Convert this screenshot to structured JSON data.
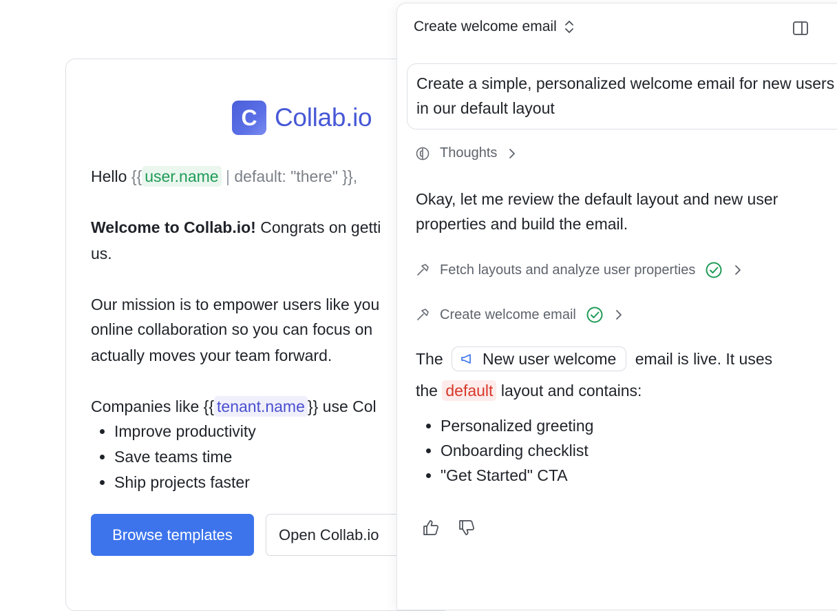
{
  "email": {
    "brand": {
      "initial": "C",
      "name": "Collab.io"
    },
    "greeting": {
      "hello": "Hello",
      "open": "{{",
      "var": "user.name",
      "sep": "|",
      "default_text": "default: \"there\"",
      "close": "}},"
    },
    "welcome": {
      "bold": "Welcome to Collab.io!",
      "rest": "Congrats on getti",
      "line2": "us."
    },
    "mission": {
      "line1": "Our mission is to empower users like you",
      "line2": "online collaboration so you can focus on",
      "line3": "actually moves your team forward."
    },
    "companies": {
      "before": "Companies like",
      "open": "{{",
      "var": "tenant.name",
      "close": "}}",
      "after": "use Col"
    },
    "bullets": [
      "Improve productivity",
      "Save teams time",
      "Ship projects faster"
    ],
    "buttons": {
      "primary": "Browse templates",
      "secondary": "Open Collab.io"
    }
  },
  "panel": {
    "title": "Create welcome email",
    "prompt": "Create a simple, personalized welcome email for new users in our default layout",
    "thoughts_label": "Thoughts",
    "reply_line1": "Okay, let me review the default layout and new user",
    "reply_line2": "properties and build the email.",
    "steps": [
      {
        "label": "Fetch layouts and analyze user properties"
      },
      {
        "label": "Create welcome email"
      }
    ],
    "summary": {
      "the": "The",
      "template_name": "New user welcome",
      "is_live": "email is live. It uses",
      "the2": "the",
      "layout": "default",
      "contains": "layout and contains:"
    },
    "contents": [
      "Personalized greeting",
      "Onboarding checklist",
      "\"Get Started\" CTA"
    ]
  },
  "colors": {
    "brand": "#4758d6",
    "primary_button": "#3d74ec",
    "success": "#1f9b57",
    "variable_green": "#1f9b57",
    "variable_purple": "#4b4fcf",
    "code_red": "#d7372b"
  },
  "icons": [
    "updown-chevron-icon",
    "sidebar-toggle-icon",
    "brain-icon",
    "chevron-right-icon",
    "hammer-icon",
    "check-circle-icon",
    "megaphone-icon",
    "thumbs-up-icon",
    "thumbs-down-icon"
  ]
}
